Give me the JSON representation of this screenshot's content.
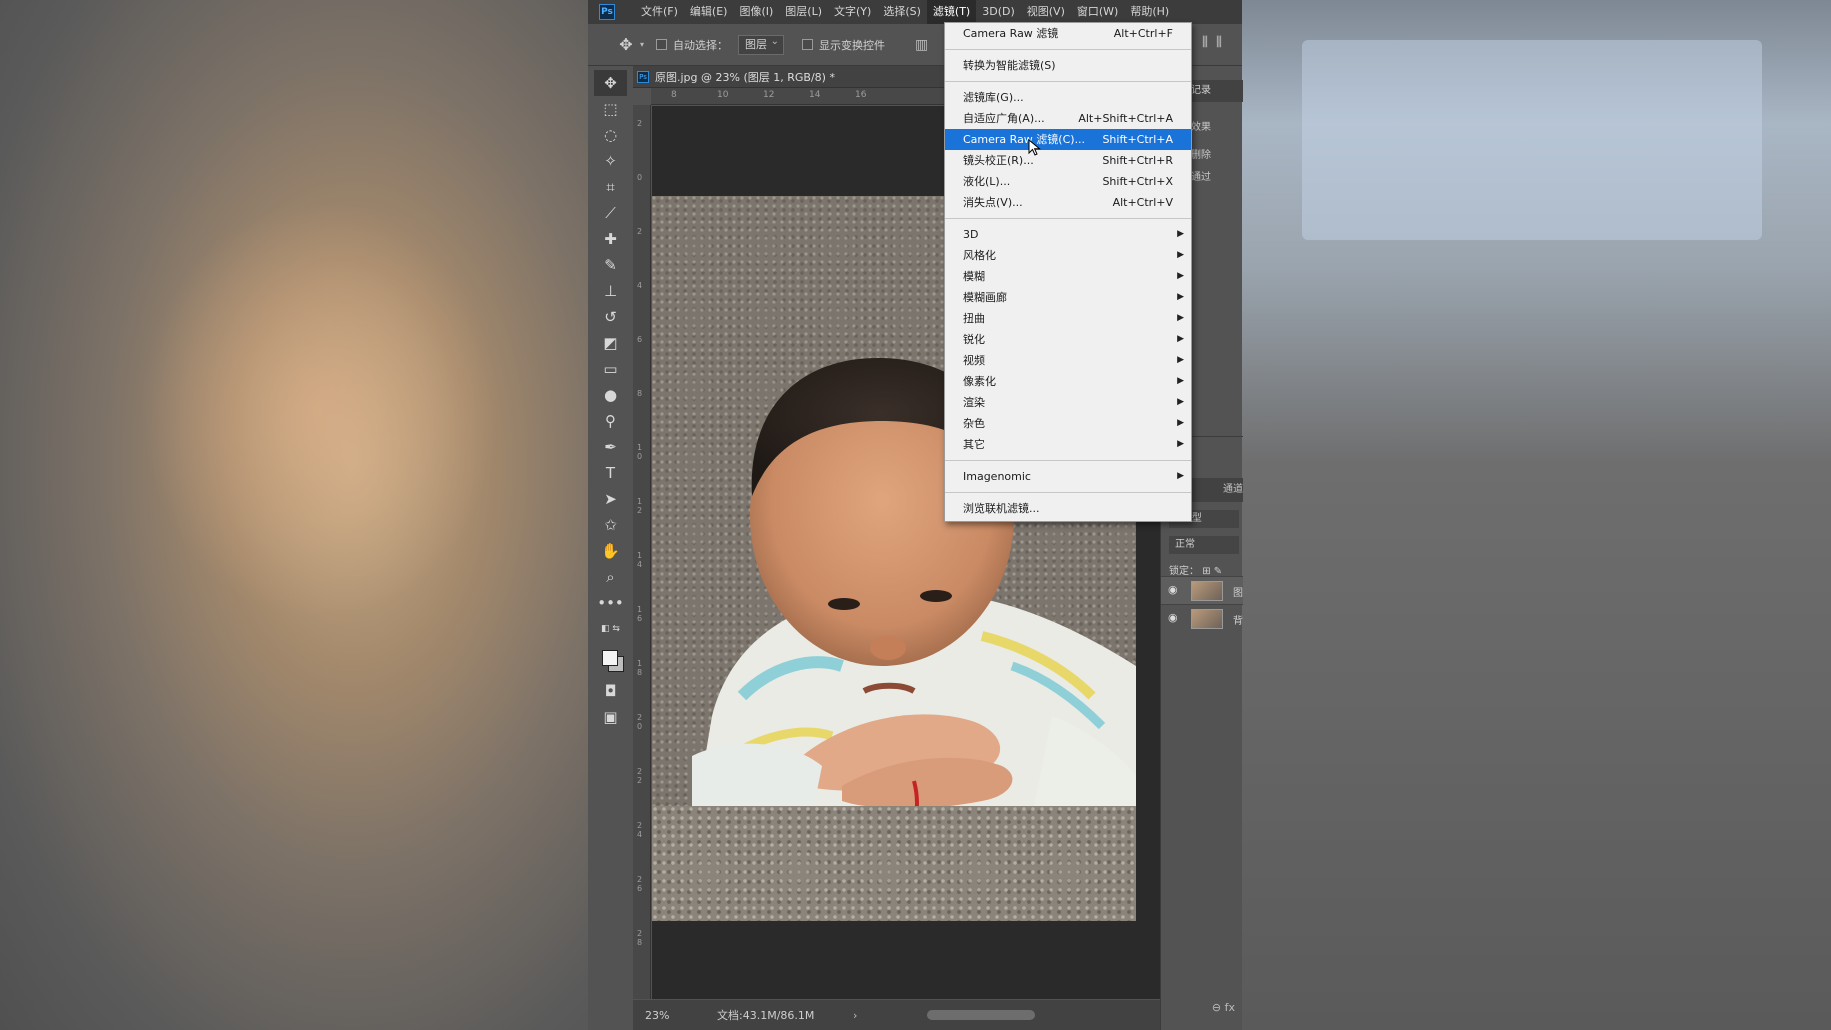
{
  "menubar": {
    "logo": "Ps",
    "items": [
      "文件(F)",
      "编辑(E)",
      "图像(I)",
      "图层(L)",
      "文字(Y)",
      "选择(S)",
      "滤镜(T)",
      "3D(D)",
      "视图(V)",
      "窗口(W)",
      "帮助(H)"
    ],
    "active_index": 6
  },
  "options": {
    "auto_select_label": "自动选择：",
    "auto_select_value": "图层",
    "show_transform_label": "显示变换控件"
  },
  "document": {
    "tab_title": "原图.jpg @ 23% (图层 1, RGB/8) *",
    "ruler_top": [
      "8",
      "10",
      "12",
      "14",
      "16"
    ],
    "ruler_left": [
      "2",
      "0",
      "2",
      "4",
      "6",
      "8",
      "10",
      "12",
      "14",
      "16",
      "18",
      "20",
      "22",
      "24",
      "26",
      "28"
    ]
  },
  "status": {
    "zoom": "23%",
    "doc_size": "文档:43.1M/86.1M"
  },
  "filter_menu": {
    "groups": [
      [
        {
          "label": "Camera Raw 滤镜",
          "shortcut": "Alt+Ctrl+F"
        }
      ],
      [
        {
          "label": "转换为智能滤镜(S)",
          "shortcut": ""
        }
      ],
      [
        {
          "label": "滤镜库(G)...",
          "shortcut": ""
        },
        {
          "label": "自适应广角(A)...",
          "shortcut": "Alt+Shift+Ctrl+A"
        },
        {
          "label": "Camera Raw 滤镜(C)...",
          "shortcut": "Shift+Ctrl+A",
          "highlighted": true
        },
        {
          "label": "镜头校正(R)...",
          "shortcut": "Shift+Ctrl+R"
        },
        {
          "label": "液化(L)...",
          "shortcut": "Shift+Ctrl+X"
        },
        {
          "label": "消失点(V)...",
          "shortcut": "Alt+Ctrl+V"
        }
      ],
      [
        {
          "label": "3D",
          "submenu": true
        },
        {
          "label": "风格化",
          "submenu": true
        },
        {
          "label": "模糊",
          "submenu": true
        },
        {
          "label": "模糊画廊",
          "submenu": true
        },
        {
          "label": "扭曲",
          "submenu": true
        },
        {
          "label": "锐化",
          "submenu": true
        },
        {
          "label": "视频",
          "submenu": true
        },
        {
          "label": "像素化",
          "submenu": true
        },
        {
          "label": "渲染",
          "submenu": true
        },
        {
          "label": "杂色",
          "submenu": true
        },
        {
          "label": "其它",
          "submenu": true
        }
      ],
      [
        {
          "label": "Imagenomic",
          "submenu": true
        }
      ],
      [
        {
          "label": "浏览联机滤镜...",
          "shortcut": ""
        }
      ]
    ]
  },
  "right_panel": {
    "history_tab": "记录",
    "history_rows": [
      "效果",
      "删除",
      "通过"
    ],
    "layers_tab": "通道",
    "kind_label": "类型",
    "blend_mode": "正常",
    "lock_label": "锁定：",
    "layers": [
      {
        "name": "图"
      },
      {
        "name": "背"
      }
    ],
    "bottom_icons": "⊖  fx"
  },
  "colors": {
    "highlight": "#1a73d9",
    "menu_bg": "#f0f0f0",
    "app_bg": "#535353"
  }
}
